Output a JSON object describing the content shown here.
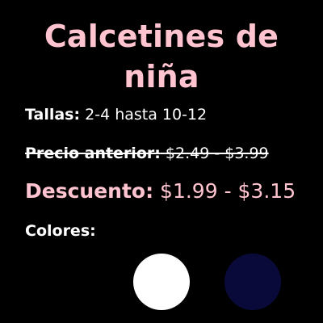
{
  "product": {
    "title_line1": "Calcetines de",
    "title_line2": "niña"
  },
  "sizes": {
    "label": "Tallas:",
    "value": "2-4 hasta 10-12"
  },
  "old_price": {
    "label": "Precio anterior:",
    "value": "$2.49 - $3.99"
  },
  "discount": {
    "label": "Descuento:",
    "value": "$1.99 - $3.15"
  },
  "colors": {
    "label": "Colores:",
    "swatches": [
      {
        "name": "white",
        "hex": "#ffffff"
      },
      {
        "name": "navy",
        "hex": "#0a0a3a"
      }
    ]
  },
  "theme": {
    "accent": "#ffc4cf",
    "background": "#000000",
    "text": "#ffffff"
  }
}
